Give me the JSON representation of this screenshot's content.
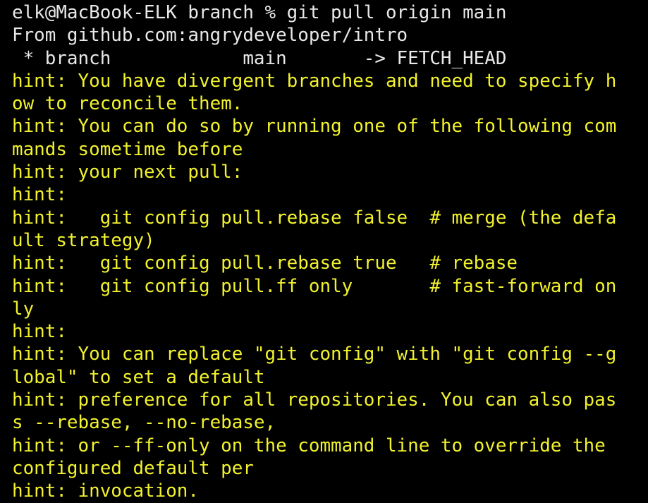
{
  "terminal": {
    "colors": {
      "background": "#000000",
      "plain_text": "#e8e8e8",
      "hint_text": "#f2f22e"
    },
    "lines": [
      {
        "text": "elk@MacBook-ELK branch % git pull origin main",
        "style": "plain"
      },
      {
        "text": "From github.com:angrydeveloper/intro",
        "style": "plain"
      },
      {
        "text": " * branch            main       -> FETCH_HEAD",
        "style": "plain"
      },
      {
        "text": "hint: You have divergent branches and need to specify h",
        "style": "hint"
      },
      {
        "text": "ow to reconcile them.",
        "style": "hint"
      },
      {
        "text": "hint: You can do so by running one of the following com",
        "style": "hint"
      },
      {
        "text": "mands sometime before",
        "style": "hint"
      },
      {
        "text": "hint: your next pull:",
        "style": "hint"
      },
      {
        "text": "hint:",
        "style": "hint"
      },
      {
        "text": "hint:   git config pull.rebase false  # merge (the defa",
        "style": "hint"
      },
      {
        "text": "ult strategy)",
        "style": "hint"
      },
      {
        "text": "hint:   git config pull.rebase true   # rebase",
        "style": "hint"
      },
      {
        "text": "hint:   git config pull.ff only       # fast-forward on",
        "style": "hint"
      },
      {
        "text": "ly",
        "style": "hint"
      },
      {
        "text": "hint:",
        "style": "hint"
      },
      {
        "text": "hint: You can replace \"git config\" with \"git config --g",
        "style": "hint"
      },
      {
        "text": "lobal\" to set a default",
        "style": "hint"
      },
      {
        "text": "hint: preference for all repositories. You can also pas",
        "style": "hint"
      },
      {
        "text": "s --rebase, --no-rebase,",
        "style": "hint"
      },
      {
        "text": "hint: or --ff-only on the command line to override the",
        "style": "hint"
      },
      {
        "text": "configured default per",
        "style": "hint"
      },
      {
        "text": "hint: invocation.",
        "style": "hint"
      }
    ]
  }
}
